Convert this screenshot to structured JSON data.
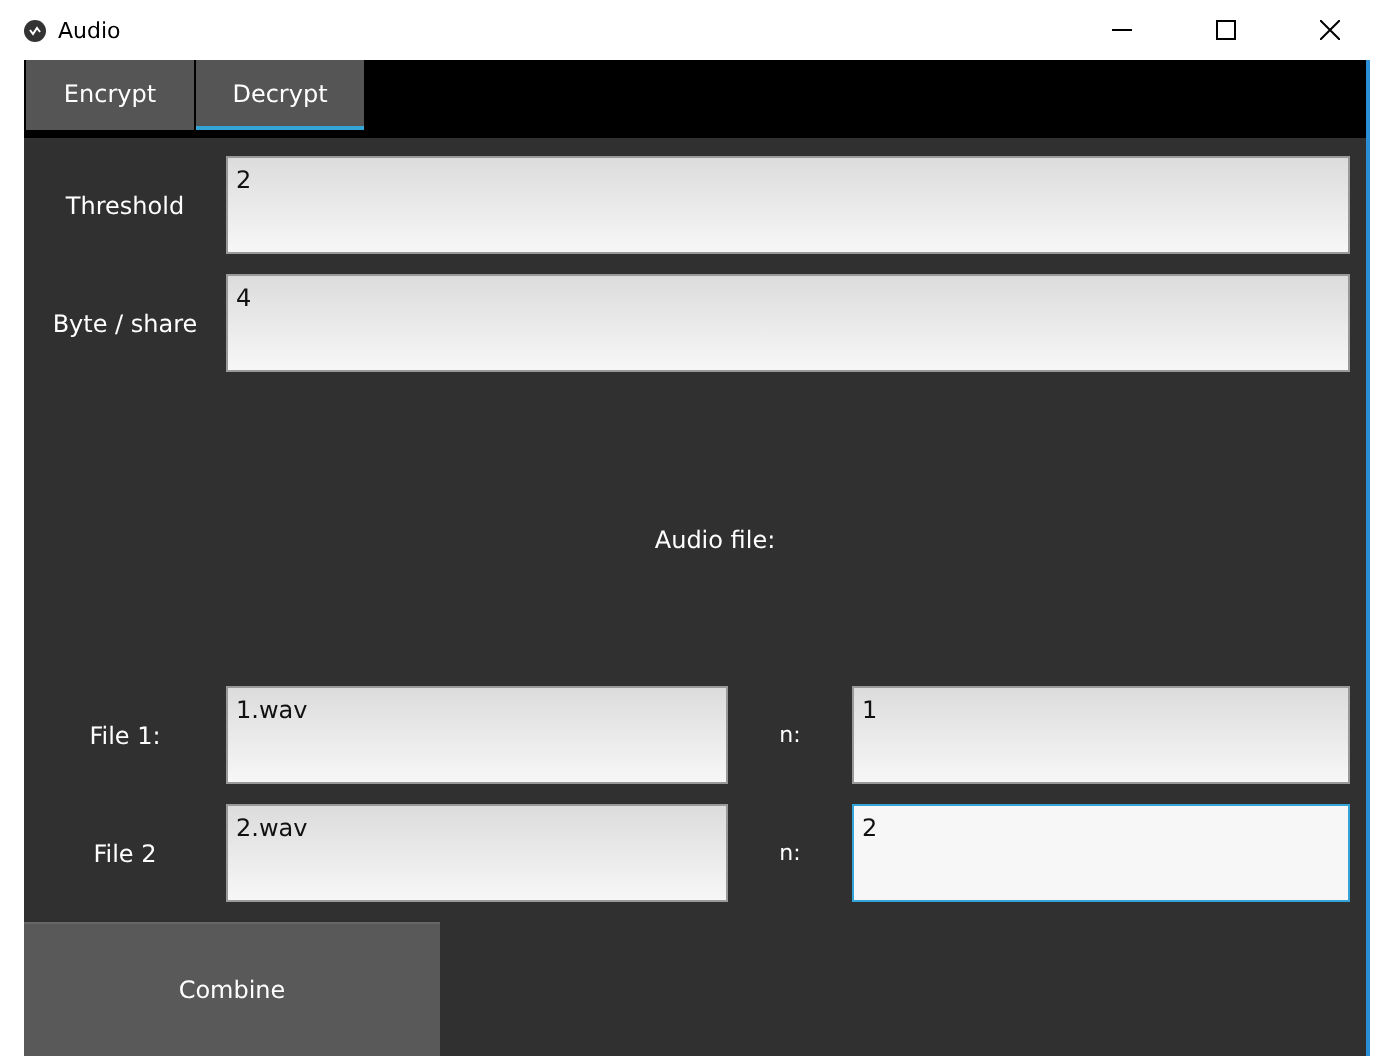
{
  "window": {
    "title": "Audio"
  },
  "tabs": [
    {
      "label": "Encrypt",
      "selected": false
    },
    {
      "label": "Decrypt",
      "selected": true
    }
  ],
  "params": [
    {
      "label": "Threshold",
      "value": "2"
    },
    {
      "label": "Byte / share",
      "value": "4"
    }
  ],
  "section_label": "Audio file:",
  "files": [
    {
      "label": "File 1:",
      "value": "1.wav",
      "n_label": "n:",
      "n_value": "1",
      "n_focused": false
    },
    {
      "label": "File 2",
      "value": "2.wav",
      "n_label": "n:",
      "n_value": "2",
      "n_focused": true
    }
  ],
  "button": "Combine"
}
